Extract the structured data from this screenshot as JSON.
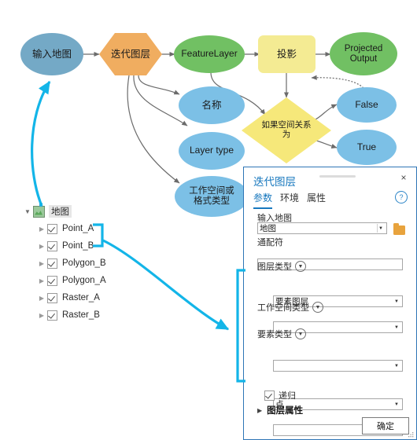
{
  "diagram": {
    "nodes": [
      {
        "id": "input-map",
        "label": "输入地图",
        "shape": "ellipse",
        "color": "#74a9c6"
      },
      {
        "id": "iterate-layers",
        "label": "迭代图层",
        "shape": "hexagon",
        "color": "#f0ad60"
      },
      {
        "id": "feature-layer",
        "label": "FeatureLayer",
        "shape": "ellipse",
        "color": "#71c063"
      },
      {
        "id": "project",
        "label": "投影",
        "shape": "rect",
        "color": "#f4eb93"
      },
      {
        "id": "projected-output",
        "label": "Projected Output",
        "shape": "ellipse",
        "color": "#71c063"
      },
      {
        "id": "name",
        "label": "名称",
        "shape": "ellipse",
        "color": "#7cc0e6"
      },
      {
        "id": "layer-type",
        "label": "Layer type",
        "shape": "ellipse",
        "color": "#7cc0e6"
      },
      {
        "id": "workspace-or-format-type",
        "label": "工作空间或 格式类型",
        "shape": "ellipse",
        "color": "#7cc0e6"
      },
      {
        "id": "if-spatial-relationship-is",
        "label": "如果空间关系 为",
        "shape": "diamond",
        "color": "#f6e87a"
      },
      {
        "id": "false",
        "label": "False",
        "shape": "ellipse",
        "color": "#7cc0e6"
      },
      {
        "id": "true",
        "label": "True",
        "shape": "ellipse",
        "color": "#7cc0e6"
      }
    ],
    "labels": {
      "input_map": "输入地图",
      "iterate_layers": "迭代图层",
      "feature_layer": "FeatureLayer",
      "project": "投影",
      "projected_output_line1": "Projected",
      "projected_output_line2": "Output",
      "name": "名称",
      "layer_type": "Layer type",
      "workspace_line1": "工作空间或",
      "workspace_line2": "格式类型",
      "if_spatial_line1": "如果空间关系",
      "if_spatial_line2": "为",
      "false": "False",
      "true": "True"
    }
  },
  "tree": {
    "root": {
      "label": "地图",
      "icon": "map-icon",
      "expanded": true
    },
    "items": [
      {
        "label": "Point_A",
        "checked": true
      },
      {
        "label": "Point_B",
        "checked": true
      },
      {
        "label": "Polygon_B",
        "checked": true
      },
      {
        "label": "Polygon_A",
        "checked": true
      },
      {
        "label": "Raster_A",
        "checked": true
      },
      {
        "label": "Raster_B",
        "checked": true
      }
    ]
  },
  "dialog": {
    "title": "迭代图层",
    "close_icon": "×",
    "help_icon": "?",
    "tabs": [
      {
        "label": "参数",
        "active": true
      },
      {
        "label": "环境",
        "active": false
      },
      {
        "label": "属性",
        "active": false
      }
    ],
    "fields": {
      "input_map": {
        "label": "输入地图",
        "value": "地图",
        "browse_icon": "folder-icon"
      },
      "wildcard": {
        "label": "通配符",
        "value": ""
      },
      "layer_type": {
        "label": "图层类型",
        "value": "要素图层",
        "extra_value": ""
      },
      "workspace_type": {
        "label": "工作空间类型",
        "value": ""
      },
      "feature_type": {
        "label": "要素类型",
        "value": "点",
        "extra_value": ""
      }
    },
    "recursive": {
      "label": "递归",
      "checked": true
    },
    "layer_properties": {
      "label": "图层属性",
      "expanded": false
    },
    "ok_button": "确定"
  },
  "colors": {
    "accent_cyan": "#13b5e8",
    "dialog_border": "#2e75b6",
    "tab_active": "#1878be",
    "node_blue": "#7cc0e6",
    "node_green": "#71c063",
    "node_orange": "#f0ad60",
    "node_yellow": "#f4eb93"
  }
}
